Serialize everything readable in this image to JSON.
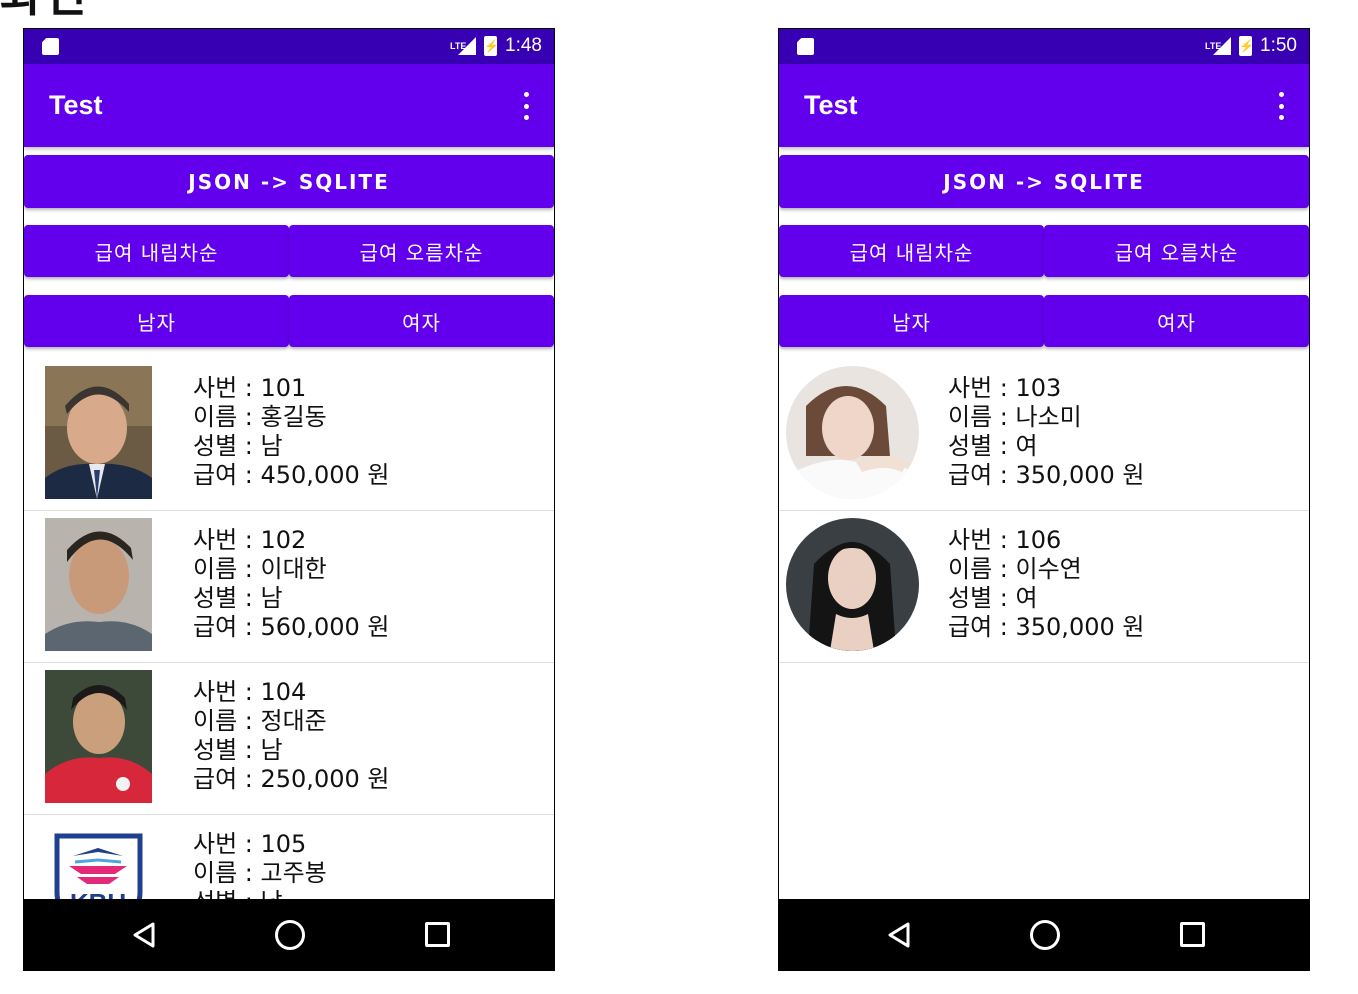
{
  "caption": "화면",
  "phones": [
    {
      "status_time": "1:48",
      "status_network": "LTE",
      "app_title": "Test",
      "buttons": {
        "json_sqlite": "JSON -> SQLITE",
        "salary_desc": "급여 내림차순",
        "salary_asc": "급여 오름차순",
        "male": "남자",
        "female": "여자"
      },
      "employees": [
        {
          "id": "사번 : 101",
          "name": "이름 : 홍길동",
          "gender": "성별 : 남",
          "salary": "급여 : 450,000 원",
          "photo": "man-suit-photo"
        },
        {
          "id": "사번 : 102",
          "name": "이름 : 이대한",
          "gender": "성별 : 남",
          "salary": "급여 : 560,000 원",
          "photo": "man-portrait-photo"
        },
        {
          "id": "사번 : 104",
          "name": "이름 : 정대준",
          "gender": "성별 : 남",
          "salary": "급여 : 250,000 원",
          "photo": "soccer-player-photo"
        },
        {
          "id": "사번 : 105",
          "name": "이름 : 고주봉",
          "gender": "성별 : 남",
          "salary": "",
          "photo": "kbu-logo"
        }
      ]
    },
    {
      "status_time": "1:50",
      "status_network": "LTE",
      "app_title": "Test",
      "buttons": {
        "json_sqlite": "JSON -> SQLITE",
        "salary_desc": "급여 내림차순",
        "salary_asc": "급여 오름차순",
        "male": "남자",
        "female": "여자"
      },
      "employees": [
        {
          "id": "사번 : 103",
          "name": "이름 : 나소미",
          "gender": "성별 : 여",
          "salary": "급여 : 350,000 원",
          "photo": "woman-white-photo"
        },
        {
          "id": "사번 : 106",
          "name": "이름 : 이수연",
          "gender": "성별 : 여",
          "salary": "급여 : 350,000 원",
          "photo": "woman-dark-photo"
        }
      ]
    }
  ],
  "colors": {
    "status_bar": "#3700b3",
    "primary": "#6200ee",
    "nav_bar": "#000000"
  }
}
